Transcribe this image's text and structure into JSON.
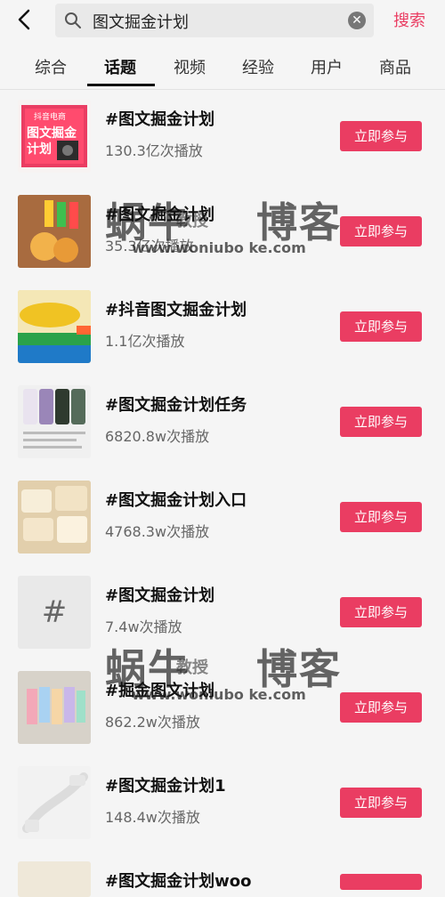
{
  "header": {
    "query": "图文掘金计划",
    "search_label": "搜索"
  },
  "tabs": [
    {
      "label": "综合"
    },
    {
      "label": "话题"
    },
    {
      "label": "视频"
    },
    {
      "label": "经验"
    },
    {
      "label": "用户"
    },
    {
      "label": "商品"
    }
  ],
  "items": [
    {
      "title": "#图文掘金计划",
      "plays": "130.3亿次播放",
      "button": "立即参与",
      "thumb_text": "抖音电商\n图文掘金\n计划"
    },
    {
      "title": "#图文掘金计划",
      "plays": "35.3亿次播放",
      "button": "立即参与"
    },
    {
      "title": "#抖音图文掘金计划",
      "plays": "1.1亿次播放",
      "button": "立即参与"
    },
    {
      "title": "#图文掘金计划任务",
      "plays": "6820.8w次播放",
      "button": "立即参与"
    },
    {
      "title": "#图文掘金计划入口",
      "plays": "4768.3w次播放",
      "button": "立即参与"
    },
    {
      "title": "#图文掘金计划",
      "plays": "7.4w次播放",
      "button": "立即参与",
      "thumb_text": "#"
    },
    {
      "title": "#掘金图文计划",
      "plays": "862.2w次播放",
      "button": "立即参与"
    },
    {
      "title": "#图文掘金计划1",
      "plays": "148.4w次播放",
      "button": "立即参与"
    },
    {
      "title": "#图文掘金计划woo",
      "plays": "",
      "button": ""
    }
  ],
  "watermark": {
    "left": "蜗牛",
    "mid": "教授",
    "right": "博客",
    "url": "www.woniubo ke.com"
  },
  "colors": {
    "accent": "#ea3d62",
    "background": "#f5f5f5"
  }
}
